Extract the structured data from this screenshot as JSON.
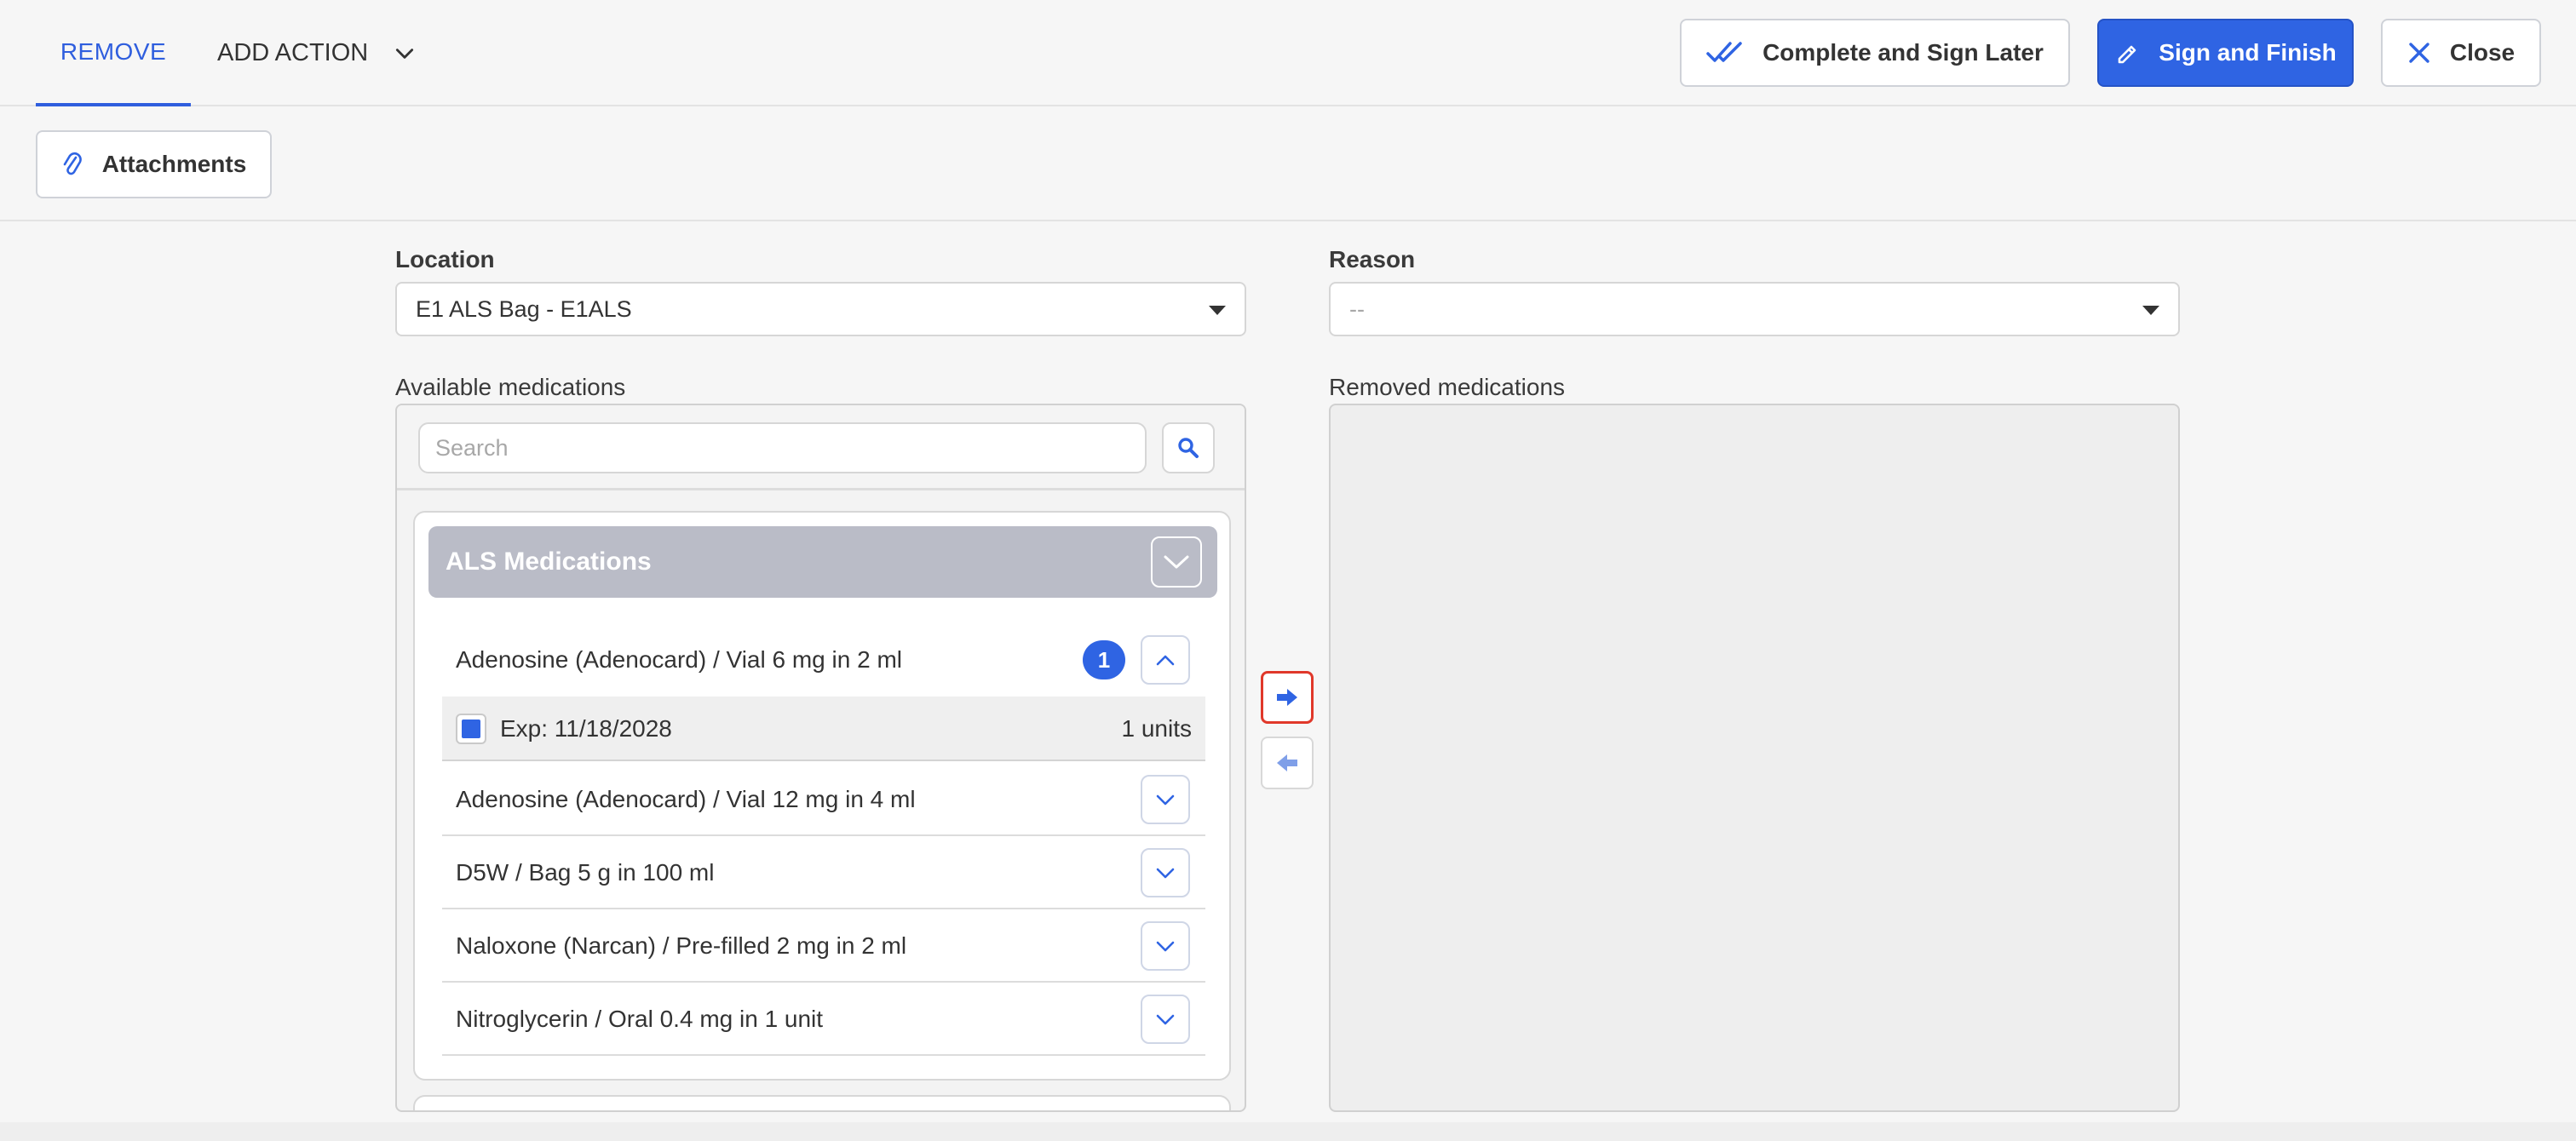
{
  "header": {
    "tab_remove": "REMOVE",
    "add_action": "ADD ACTION",
    "complete_later": "Complete and Sign Later",
    "sign_finish": "Sign and Finish",
    "close": "Close"
  },
  "toolbar": {
    "attachments": "Attachments"
  },
  "form": {
    "location_label": "Location",
    "location_value": "E1 ALS Bag - E1ALS",
    "reason_label": "Reason",
    "reason_value": "--"
  },
  "available": {
    "label": "Available medications",
    "search_placeholder": "Search",
    "group": {
      "title": "ALS Medications",
      "items": [
        {
          "name": "Adenosine (Adenocard) / Vial 6 mg in 2 ml",
          "count": "1",
          "expanded": true
        },
        {
          "name": "Adenosine (Adenocard) / Vial 12 mg in 4 ml"
        },
        {
          "name": "D5W / Bag 5 g in 100 ml"
        },
        {
          "name": "Naloxone (Narcan) / Pre-filled 2 mg in 2 ml"
        },
        {
          "name": "Nitroglycerin / Oral 0.4 mg in 1 unit"
        }
      ],
      "lot": {
        "exp": "Exp: 11/18/2028",
        "units": "1 units",
        "checked": true
      }
    }
  },
  "removed": {
    "label": "Removed medications"
  },
  "colors": {
    "accent": "#2f64e3",
    "highlight_border": "#e0382a",
    "group_header": "#babcc7"
  },
  "icons": {
    "complete_later": "double-check-icon",
    "sign_finish": "pen-icon",
    "close": "close-icon",
    "attachments": "paperclip-icon",
    "search": "search-icon",
    "transfer_right": "arrow-right-icon",
    "transfer_left": "arrow-left-icon"
  }
}
